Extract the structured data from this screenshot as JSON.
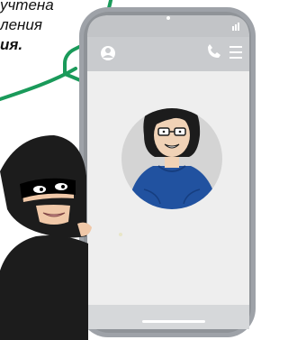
{
  "caption": {
    "lines": [
      "учтена",
      "ления",
      "ия."
    ]
  },
  "colors": {
    "bubble_outline": "#1a9a5a",
    "phone_frame": "#9ea2a8",
    "phone_screen": "#eeeeee",
    "status_bar": "#bfc1c4",
    "avatar_bg": "#d4d4d4",
    "sweater": "#2152a0",
    "mask": "#1c1c1c"
  },
  "icons": {
    "signal": "signal-bars-icon",
    "profile": "user-profile-icon",
    "phone": "phone-handset-icon",
    "menu": "hamburger-menu-icon"
  }
}
